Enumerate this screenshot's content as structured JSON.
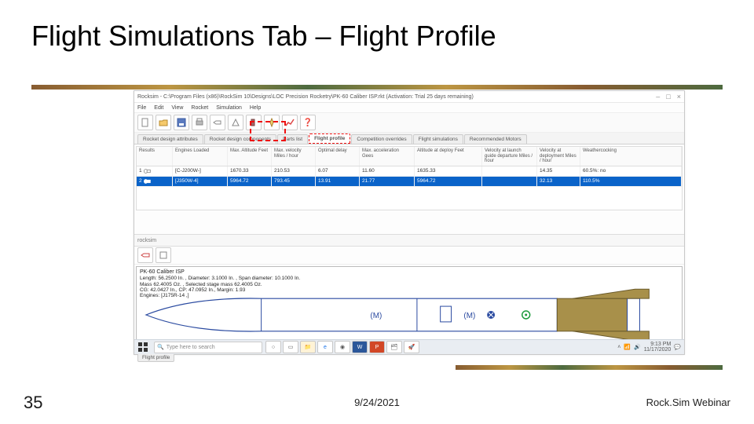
{
  "slide": {
    "title": "Flight Simulations Tab – Flight Profile",
    "number": "35",
    "date": "9/24/2021",
    "footer": "Rock.Sim Webinar"
  },
  "app": {
    "titlebar": "Rocksim - C:\\Program Files (x86)\\RockSim 10\\Designs\\LOC Precision Rocketry\\PK-60 Caliber ISP.rkt  (Activation: Trial 25 days remaining)",
    "window_controls": {
      "min": "–",
      "max": "□",
      "close": "×"
    },
    "menus": [
      "File",
      "Edit",
      "View",
      "Rocket",
      "Simulation",
      "Help"
    ],
    "tabs": [
      "Rocket design attributes",
      "Rocket design components",
      "Parts list",
      "Flight profile",
      "Competition overrides",
      "Flight simulations",
      "Recommended Motors"
    ],
    "active_tab": "Flight profile",
    "grid": {
      "headers": [
        "Results",
        "Engines Loaded",
        "Max. Altitude\nFeet",
        "Max. velocity\nMiles / hour",
        "Optimal delay",
        "Max. acceleration\nGees",
        "Altitude at deploy\nFeet",
        "Velocity at launch guide departure\nMiles / hour",
        "Velocity at deployment\nMiles / hour",
        "Weathercocking"
      ],
      "rows": [
        {
          "idx": "1",
          "sel": false,
          "icon": "engine",
          "cells": [
            "[C-J200W-]",
            "1670.33",
            "210.53",
            "6.07",
            "11.60",
            "1635.33",
            "",
            "14.35",
            "60.5%: no"
          ]
        },
        {
          "idx": "2",
          "sel": true,
          "icon": "engine",
          "cells": [
            "[J350W-4]",
            "5964.72",
            "793.45",
            "13.91",
            "21.77",
            "5964.72",
            "",
            "32.13",
            "110.5%"
          ]
        }
      ]
    },
    "mid_label": "rocksim",
    "rocket": {
      "title": "PK-60 Caliber ISP",
      "line1": "Length: 56.2500 In. , Diameter: 3.1000 In. , Span diameter: 10.1000 In.",
      "line2": "Mass 62.4005 Oz. , Selected stage mass 62.4005 Oz.",
      "line3": "CG: 42.0427 In., CP: 47.0952 In., Margin: 1.93",
      "line4": "Engines: [J175R-14 ,]",
      "markers": {
        "m1": "(M)",
        "m2": "(M)"
      }
    },
    "bottom_tab": "Flight profile"
  },
  "taskbar": {
    "search_placeholder": "Type here to search",
    "time": "9:13 PM",
    "date": "11/17/2020"
  }
}
